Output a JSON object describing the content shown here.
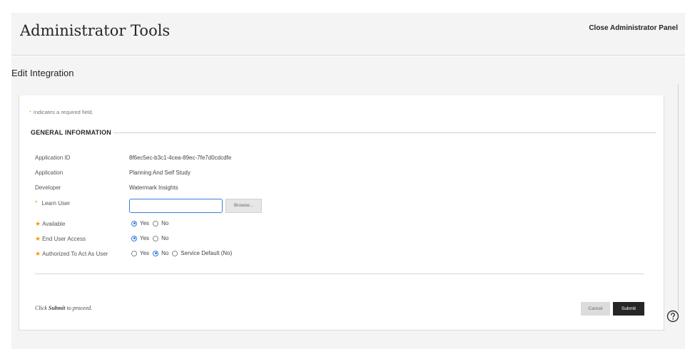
{
  "header": {
    "title": "Administrator Tools",
    "close_label": "Close Administrator Panel"
  },
  "subheader": {
    "title": "Edit Integration"
  },
  "form": {
    "required_note": "Indicates a required field.",
    "required_marker": "*",
    "section_title": "GENERAL INFORMATION",
    "fields": {
      "application_id": {
        "label": "Application ID",
        "value": "8f6ec5ec-b3c1-4cea-89ec-7fe7d0cdcdfe"
      },
      "application": {
        "label": "Application",
        "value": "Planning And Self Study"
      },
      "developer": {
        "label": "Developer",
        "value": "Watermark Insights"
      },
      "learn_user": {
        "label": "Learn User",
        "value": "",
        "browse_label": "Browse..."
      },
      "available": {
        "label": "Available",
        "options": [
          "Yes",
          "No"
        ],
        "selected": "Yes"
      },
      "end_user_access": {
        "label": "End User Access",
        "options": [
          "Yes",
          "No"
        ],
        "selected": "Yes"
      },
      "authorized_as_user": {
        "label": "Authorized To Act As User",
        "options": [
          "Yes",
          "No",
          "Service Default (No)"
        ],
        "selected": "No"
      }
    },
    "proceed_prefix": "Click ",
    "proceed_bold": "Submit",
    "proceed_suffix": " to proceed.",
    "cancel_label": "Cancel",
    "submit_label": "Submit"
  },
  "colors": {
    "required_star": "#f39c12",
    "radio_selected": "#2f7bd9",
    "submit_bg": "#262626"
  },
  "icons": {
    "help": "help-circle-icon"
  }
}
